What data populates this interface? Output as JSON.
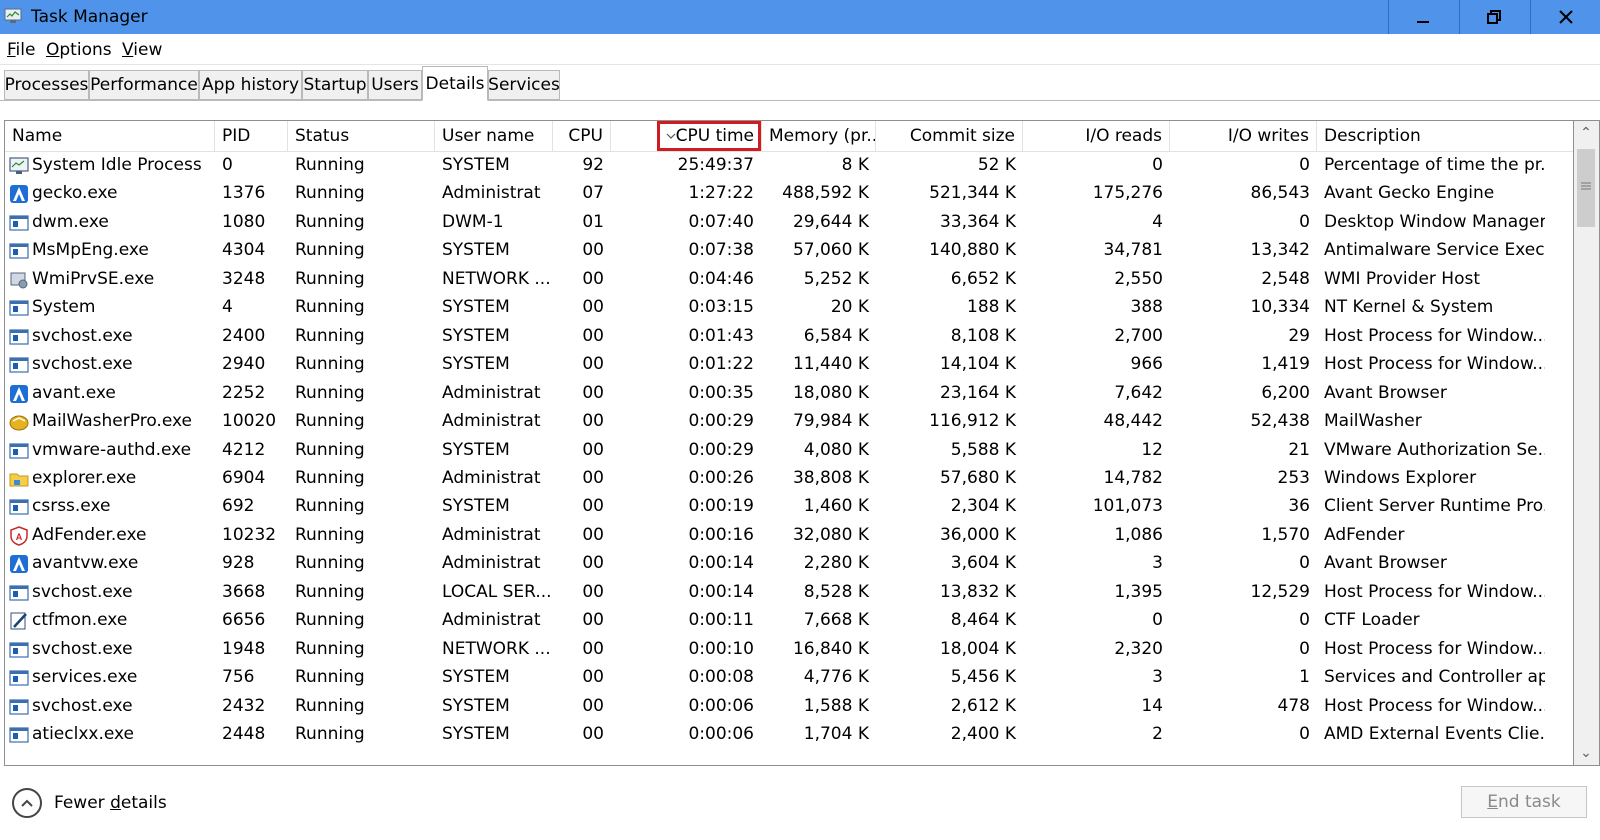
{
  "window": {
    "title": "Task Manager",
    "minimize_label": "minimize",
    "maximize_label": "restore",
    "close_label": "close"
  },
  "menu": [
    {
      "label": "File",
      "key": "F",
      "rest": "ile"
    },
    {
      "label": "Options",
      "key": "O",
      "rest": "ptions"
    },
    {
      "label": "View",
      "key": "V",
      "rest": "iew"
    }
  ],
  "tabs": [
    {
      "label": "Processes",
      "active": false
    },
    {
      "label": "Performance",
      "active": false
    },
    {
      "label": "App history",
      "active": false
    },
    {
      "label": "Startup",
      "active": false
    },
    {
      "label": "Users",
      "active": false
    },
    {
      "label": "Details",
      "active": true
    },
    {
      "label": "Services",
      "active": false
    }
  ],
  "columns": [
    {
      "key": "name",
      "label": "Name"
    },
    {
      "key": "pid",
      "label": "PID"
    },
    {
      "key": "status",
      "label": "Status"
    },
    {
      "key": "user",
      "label": "User name"
    },
    {
      "key": "cpu",
      "label": "CPU"
    },
    {
      "key": "cputime",
      "label": "CPU time",
      "sorted": true
    },
    {
      "key": "memory",
      "label": "Memory (pr..."
    },
    {
      "key": "commit",
      "label": "Commit size"
    },
    {
      "key": "ioreads",
      "label": "I/O reads"
    },
    {
      "key": "iowrites",
      "label": "I/O writes"
    },
    {
      "key": "desc",
      "label": "Description"
    }
  ],
  "rows": [
    {
      "icon": "system-idle-icon",
      "name": "System Idle Process",
      "pid": "0",
      "status": "Running",
      "user": "SYSTEM",
      "cpu": "92",
      "cputime": "25:49:37",
      "memory": "8 K",
      "commit": "52 K",
      "ioreads": "0",
      "iowrites": "0",
      "desc": "Percentage of time the pr..."
    },
    {
      "icon": "avant-icon",
      "name": "gecko.exe",
      "pid": "1376",
      "status": "Running",
      "user": "Administrat",
      "cpu": "07",
      "cputime": "1:27:22",
      "memory": "488,592 K",
      "commit": "521,344 K",
      "ioreads": "175,276",
      "iowrites": "86,543",
      "desc": "Avant Gecko Engine"
    },
    {
      "icon": "process-icon",
      "name": "dwm.exe",
      "pid": "1080",
      "status": "Running",
      "user": "DWM-1",
      "cpu": "01",
      "cputime": "0:07:40",
      "memory": "29,644 K",
      "commit": "33,364 K",
      "ioreads": "4",
      "iowrites": "0",
      "desc": "Desktop Window Manager"
    },
    {
      "icon": "process-icon",
      "name": "MsMpEng.exe",
      "pid": "4304",
      "status": "Running",
      "user": "SYSTEM",
      "cpu": "00",
      "cputime": "0:07:38",
      "memory": "57,060 K",
      "commit": "140,880 K",
      "ioreads": "34,781",
      "iowrites": "13,342",
      "desc": "Antimalware Service Exec..."
    },
    {
      "icon": "wmi-icon",
      "name": "WmiPrvSE.exe",
      "pid": "3248",
      "status": "Running",
      "user": "NETWORK ...",
      "cpu": "00",
      "cputime": "0:04:46",
      "memory": "5,252 K",
      "commit": "6,652 K",
      "ioreads": "2,550",
      "iowrites": "2,548",
      "desc": "WMI Provider Host"
    },
    {
      "icon": "process-icon",
      "name": "System",
      "pid": "4",
      "status": "Running",
      "user": "SYSTEM",
      "cpu": "00",
      "cputime": "0:03:15",
      "memory": "20 K",
      "commit": "188 K",
      "ioreads": "388",
      "iowrites": "10,334",
      "desc": "NT Kernel & System"
    },
    {
      "icon": "process-icon",
      "name": "svchost.exe",
      "pid": "2400",
      "status": "Running",
      "user": "SYSTEM",
      "cpu": "00",
      "cputime": "0:01:43",
      "memory": "6,584 K",
      "commit": "8,108 K",
      "ioreads": "2,700",
      "iowrites": "29",
      "desc": "Host Process for Window..."
    },
    {
      "icon": "process-icon",
      "name": "svchost.exe",
      "pid": "2940",
      "status": "Running",
      "user": "SYSTEM",
      "cpu": "00",
      "cputime": "0:01:22",
      "memory": "11,440 K",
      "commit": "14,104 K",
      "ioreads": "966",
      "iowrites": "1,419",
      "desc": "Host Process for Window..."
    },
    {
      "icon": "avant-icon",
      "name": "avant.exe",
      "pid": "2252",
      "status": "Running",
      "user": "Administrat",
      "cpu": "00",
      "cputime": "0:00:35",
      "memory": "18,080 K",
      "commit": "23,164 K",
      "ioreads": "7,642",
      "iowrites": "6,200",
      "desc": "Avant Browser"
    },
    {
      "icon": "mailwasher-icon",
      "name": "MailWasherPro.exe",
      "pid": "10020",
      "status": "Running",
      "user": "Administrat",
      "cpu": "00",
      "cputime": "0:00:29",
      "memory": "79,984 K",
      "commit": "116,912 K",
      "ioreads": "48,442",
      "iowrites": "52,438",
      "desc": "MailWasher"
    },
    {
      "icon": "process-icon",
      "name": "vmware-authd.exe",
      "pid": "4212",
      "status": "Running",
      "user": "SYSTEM",
      "cpu": "00",
      "cputime": "0:00:29",
      "memory": "4,080 K",
      "commit": "5,588 K",
      "ioreads": "12",
      "iowrites": "21",
      "desc": "VMware Authorization Se..."
    },
    {
      "icon": "explorer-folder-icon",
      "name": "explorer.exe",
      "pid": "6904",
      "status": "Running",
      "user": "Administrat",
      "cpu": "00",
      "cputime": "0:00:26",
      "memory": "38,808 K",
      "commit": "57,680 K",
      "ioreads": "14,782",
      "iowrites": "253",
      "desc": "Windows Explorer"
    },
    {
      "icon": "process-icon",
      "name": "csrss.exe",
      "pid": "692",
      "status": "Running",
      "user": "SYSTEM",
      "cpu": "00",
      "cputime": "0:00:19",
      "memory": "1,460 K",
      "commit": "2,304 K",
      "ioreads": "101,073",
      "iowrites": "36",
      "desc": "Client Server Runtime Pro..."
    },
    {
      "icon": "adfender-icon",
      "name": "AdFender.exe",
      "pid": "10232",
      "status": "Running",
      "user": "Administrat",
      "cpu": "00",
      "cputime": "0:00:16",
      "memory": "32,080 K",
      "commit": "36,000 K",
      "ioreads": "1,086",
      "iowrites": "1,570",
      "desc": "AdFender"
    },
    {
      "icon": "avant-icon",
      "name": "avantvw.exe",
      "pid": "928",
      "status": "Running",
      "user": "Administrat",
      "cpu": "00",
      "cputime": "0:00:14",
      "memory": "2,280 K",
      "commit": "3,604 K",
      "ioreads": "3",
      "iowrites": "0",
      "desc": "Avant Browser"
    },
    {
      "icon": "process-icon",
      "name": "svchost.exe",
      "pid": "3668",
      "status": "Running",
      "user": "LOCAL SER...",
      "cpu": "00",
      "cputime": "0:00:14",
      "memory": "8,528 K",
      "commit": "13,832 K",
      "ioreads": "1,395",
      "iowrites": "12,529",
      "desc": "Host Process for Window..."
    },
    {
      "icon": "ctf-pen-icon",
      "name": "ctfmon.exe",
      "pid": "6656",
      "status": "Running",
      "user": "Administrat",
      "cpu": "00",
      "cputime": "0:00:11",
      "memory": "7,668 K",
      "commit": "8,464 K",
      "ioreads": "0",
      "iowrites": "0",
      "desc": "CTF Loader"
    },
    {
      "icon": "process-icon",
      "name": "svchost.exe",
      "pid": "1948",
      "status": "Running",
      "user": "NETWORK ...",
      "cpu": "00",
      "cputime": "0:00:10",
      "memory": "16,840 K",
      "commit": "18,004 K",
      "ioreads": "2,320",
      "iowrites": "0",
      "desc": "Host Process for Window..."
    },
    {
      "icon": "process-icon",
      "name": "services.exe",
      "pid": "756",
      "status": "Running",
      "user": "SYSTEM",
      "cpu": "00",
      "cputime": "0:00:08",
      "memory": "4,776 K",
      "commit": "5,456 K",
      "ioreads": "3",
      "iowrites": "1",
      "desc": "Services and Controller app"
    },
    {
      "icon": "process-icon",
      "name": "svchost.exe",
      "pid": "2432",
      "status": "Running",
      "user": "SYSTEM",
      "cpu": "00",
      "cputime": "0:00:06",
      "memory": "1,588 K",
      "commit": "2,612 K",
      "ioreads": "14",
      "iowrites": "478",
      "desc": "Host Process for Window..."
    },
    {
      "icon": "process-icon",
      "name": "atieclxx.exe",
      "pid": "2448",
      "status": "Running",
      "user": "SYSTEM",
      "cpu": "00",
      "cputime": "0:00:06",
      "memory": "1,704 K",
      "commit": "2,400 K",
      "ioreads": "2",
      "iowrites": "0",
      "desc": "AMD External Events Clie..."
    }
  ],
  "footer": {
    "fewer_details_pre": "Fewer ",
    "fewer_details_key": "d",
    "fewer_details_post": "etails",
    "end_task_pre": "",
    "end_task_key": "E",
    "end_task_post": "nd task"
  },
  "colors": {
    "titlebar": "#4f94ea",
    "sort_highlight": "#d11b22",
    "process_icon_blue": "#1a5fb4"
  }
}
